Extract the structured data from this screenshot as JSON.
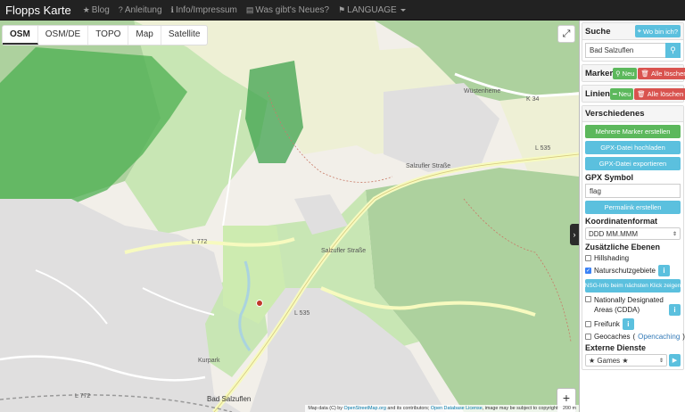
{
  "navbar": {
    "brand": "Flopps Karte",
    "links": [
      {
        "icon": "star-icon",
        "glyph": "★",
        "label": "Blog"
      },
      {
        "icon": "question-icon",
        "glyph": "?",
        "label": "Anleitung"
      },
      {
        "icon": "info-icon",
        "glyph": "ℹ",
        "label": "Info/Impressum"
      },
      {
        "icon": "newspaper-icon",
        "glyph": "▤",
        "label": "Was gibt's Neues?"
      },
      {
        "icon": "flag-icon",
        "glyph": "⚑",
        "label": "LANGUAGE"
      }
    ]
  },
  "map": {
    "layer_tabs": [
      "OSM",
      "OSM/DE",
      "TOPO",
      "Map",
      "Satellite"
    ],
    "active_layer": "OSM",
    "zoom_in": "+",
    "zoom_out": "−",
    "attribution": {
      "prefix": "Map data (C) by",
      "osm": "OpenStreetMap.org",
      "middle": "and its contributors;",
      "odbl": "Open Database License",
      "suffix": ", image may be subject to copyright",
      "scale": "200 m"
    },
    "labels": {
      "town": "Bad Salzuflen",
      "wuestenhsn": "Wüstenheme",
      "road_l772a": "L 772",
      "road_l772b": "L 772",
      "road_l535": "L 535",
      "road_l535b": "L 535",
      "road_k34": "K 34",
      "street_salzufler": "Salzufler Straße",
      "street_salzufler2": "Salzufler Straße",
      "park": "Kurpark"
    }
  },
  "sidebar": {
    "search": {
      "title": "Suche",
      "locate_label": "Wo bin ich?",
      "value": "Bad Salzuflen"
    },
    "marker": {
      "title": "Marker",
      "new_label": "Neu",
      "delete_label": "Alle löschen"
    },
    "lines": {
      "title": "Linien",
      "new_label": "Neu",
      "delete_label": "Alle löschen"
    },
    "misc": {
      "title": "Verschiedenes",
      "multi_marker": "Mehrere Marker erstellen",
      "gpx_upload": "GPX-Datei hochladen",
      "gpx_export": "GPX-Datei exportieren",
      "gpx_symbol_label": "GPX Symbol",
      "gpx_symbol_value": "flag",
      "permalink": "Permalink erstellen",
      "coord_format_label": "Koordinatenformat",
      "coord_format_value": "DDD MM.MMM",
      "layers_label": "Zusätzliche Ebenen",
      "hillshading": "Hillshading",
      "hillshading_checked": false,
      "nsg": "Naturschutzgebiete",
      "nsg_checked": true,
      "nsg_info": "NSG-Info beim nächsten Klick zeigen",
      "cdda": "Nationally Designated Areas (CDDA)",
      "cdda_checked": false,
      "freifunk": "Freifunk",
      "freifunk_checked": false,
      "geocaches": "Geocaches",
      "opencaching": "Opencaching",
      "geocaches_checked": false,
      "external_label": "Externe Dienste",
      "external_value": "★ Games ★"
    }
  }
}
